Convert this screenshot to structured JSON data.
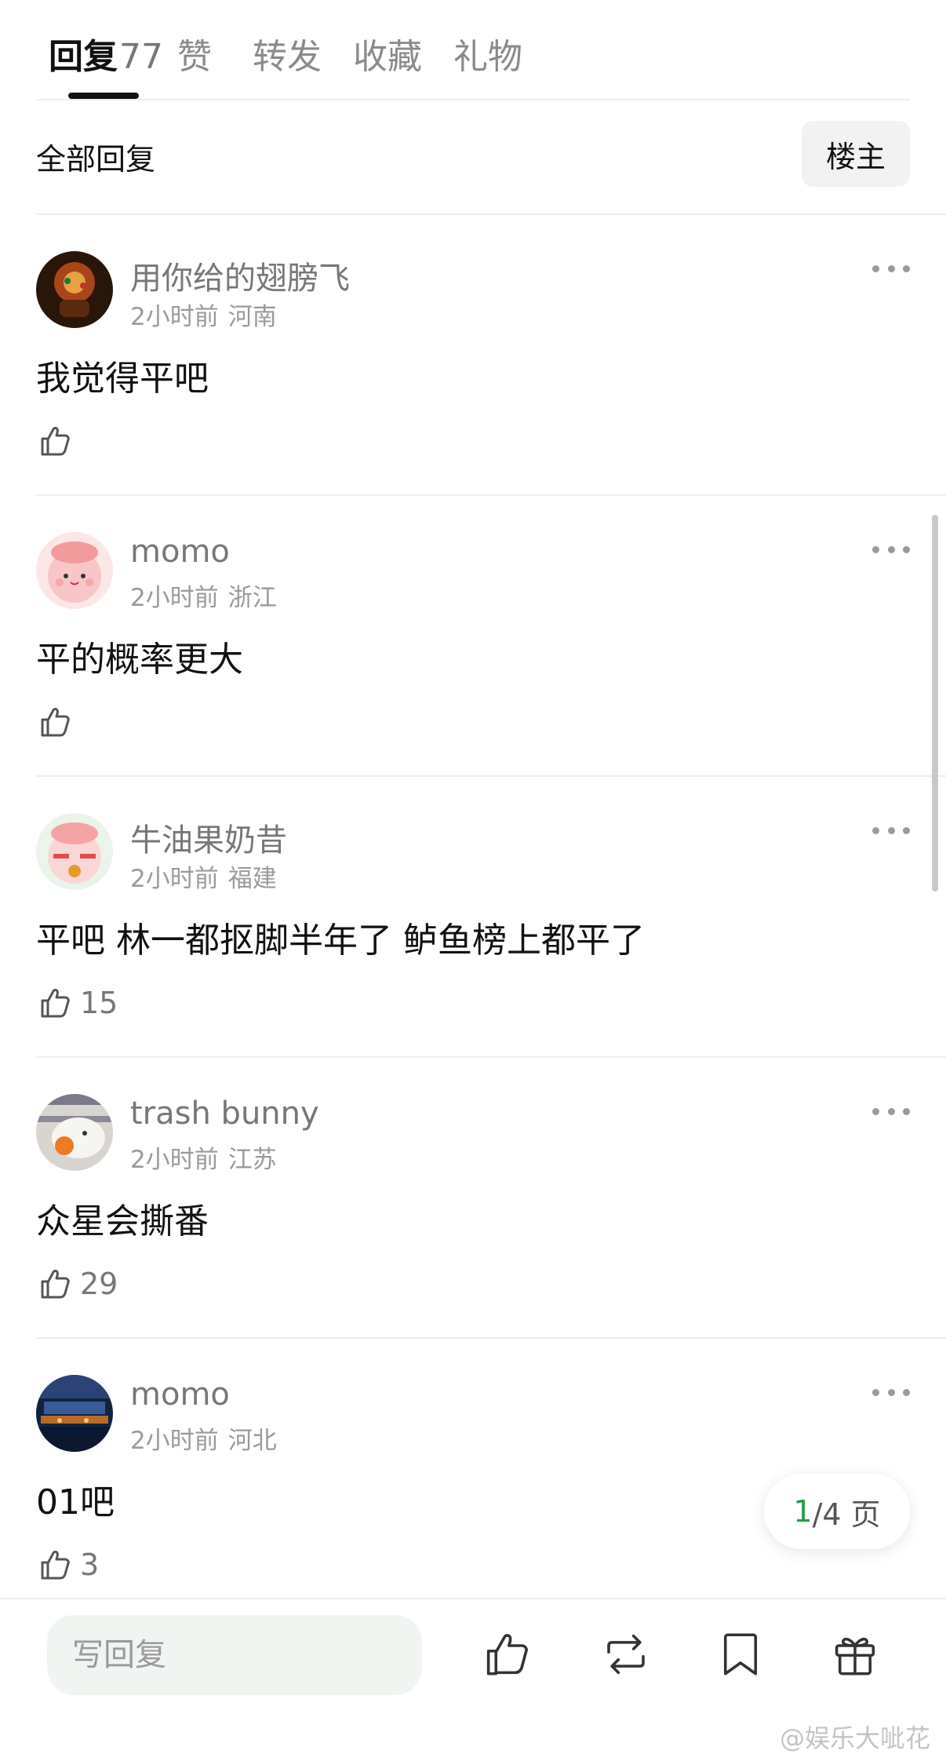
{
  "tabs": [
    {
      "label": "回复",
      "count": "77"
    },
    {
      "label": "赞"
    },
    {
      "label": "转发"
    },
    {
      "label": "收藏"
    },
    {
      "label": "礼物"
    }
  ],
  "filter": {
    "label": "全部回复",
    "owner_button": "楼主"
  },
  "comments": [
    {
      "username": "用你给的翅膀飞",
      "time": "2小时前",
      "location": "河南",
      "text": "我觉得平吧",
      "likes": ""
    },
    {
      "username": "momo",
      "time": "2小时前",
      "location": "浙江",
      "text": "平的概率更大",
      "likes": ""
    },
    {
      "username": "牛油果奶昔",
      "time": "2小时前",
      "location": "福建",
      "text": "平吧 林一都抠脚半年了 鲈鱼榜上都平了",
      "likes": "15"
    },
    {
      "username": "trash bunny",
      "time": "2小时前",
      "location": "江苏",
      "text": "众星会撕番",
      "likes": "29"
    },
    {
      "username": "momo",
      "time": "2小时前",
      "location": "河北",
      "text": "01吧",
      "likes": "3"
    }
  ],
  "pagination": {
    "current": "1",
    "total_text": "/4 页"
  },
  "bottom_bar": {
    "reply_placeholder": "写回复"
  },
  "watermark": "@娱乐大呲花",
  "icons": {
    "like": "thumbs-up-icon",
    "repost": "repost-icon",
    "favorite": "bookmark-icon",
    "gift": "gift-icon",
    "more": "more-dots-icon"
  },
  "colors": {
    "accent_green": "#1f9d4a",
    "text_primary": "#111111",
    "text_secondary": "#777777"
  }
}
